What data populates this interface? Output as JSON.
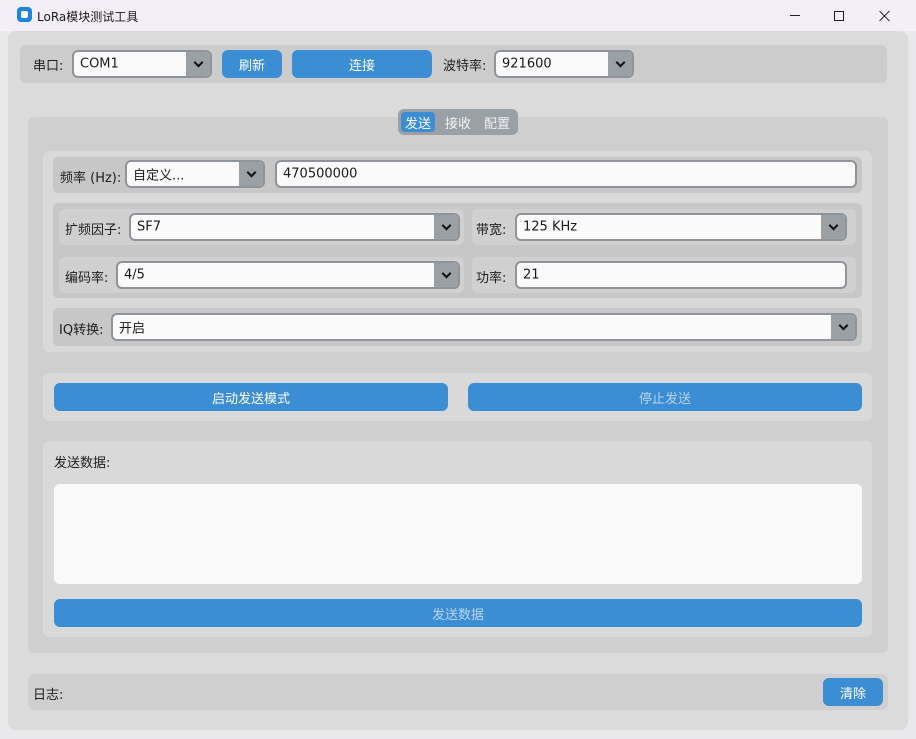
{
  "window": {
    "title": "LoRa模块测试工具"
  },
  "top": {
    "port_label": "串口:",
    "port_value": "COM1",
    "refresh_label": "刷新",
    "connect_label": "连接",
    "baud_label": "波特率:",
    "baud_value": "921600"
  },
  "tabs": [
    {
      "label": "发送",
      "active": true
    },
    {
      "label": "接收",
      "active": false
    },
    {
      "label": "配置",
      "active": false
    }
  ],
  "config": {
    "freq_label": "频率 (Hz):",
    "freq_mode": "自定义...",
    "freq_value": "470500000",
    "sf_label": "扩频因子:",
    "sf_value": "SF7",
    "bw_label": "带宽:",
    "bw_value": "125 KHz",
    "cr_label": "编码率:",
    "cr_value": "4/5",
    "power_label": "功率:",
    "power_value": "21",
    "iq_label": "IQ转换:",
    "iq_value": "开启"
  },
  "actions": {
    "start_label": "启动发送模式",
    "stop_label": "停止发送"
  },
  "send": {
    "label": "发送数据:",
    "data": "",
    "send_button": "发送数据"
  },
  "log": {
    "label": "日志:",
    "clear_label": "清除"
  },
  "colors": {
    "accent": "#3b8ed4",
    "window_bg": "#dbdbdb",
    "panel_bg": "#cfcfcf"
  }
}
